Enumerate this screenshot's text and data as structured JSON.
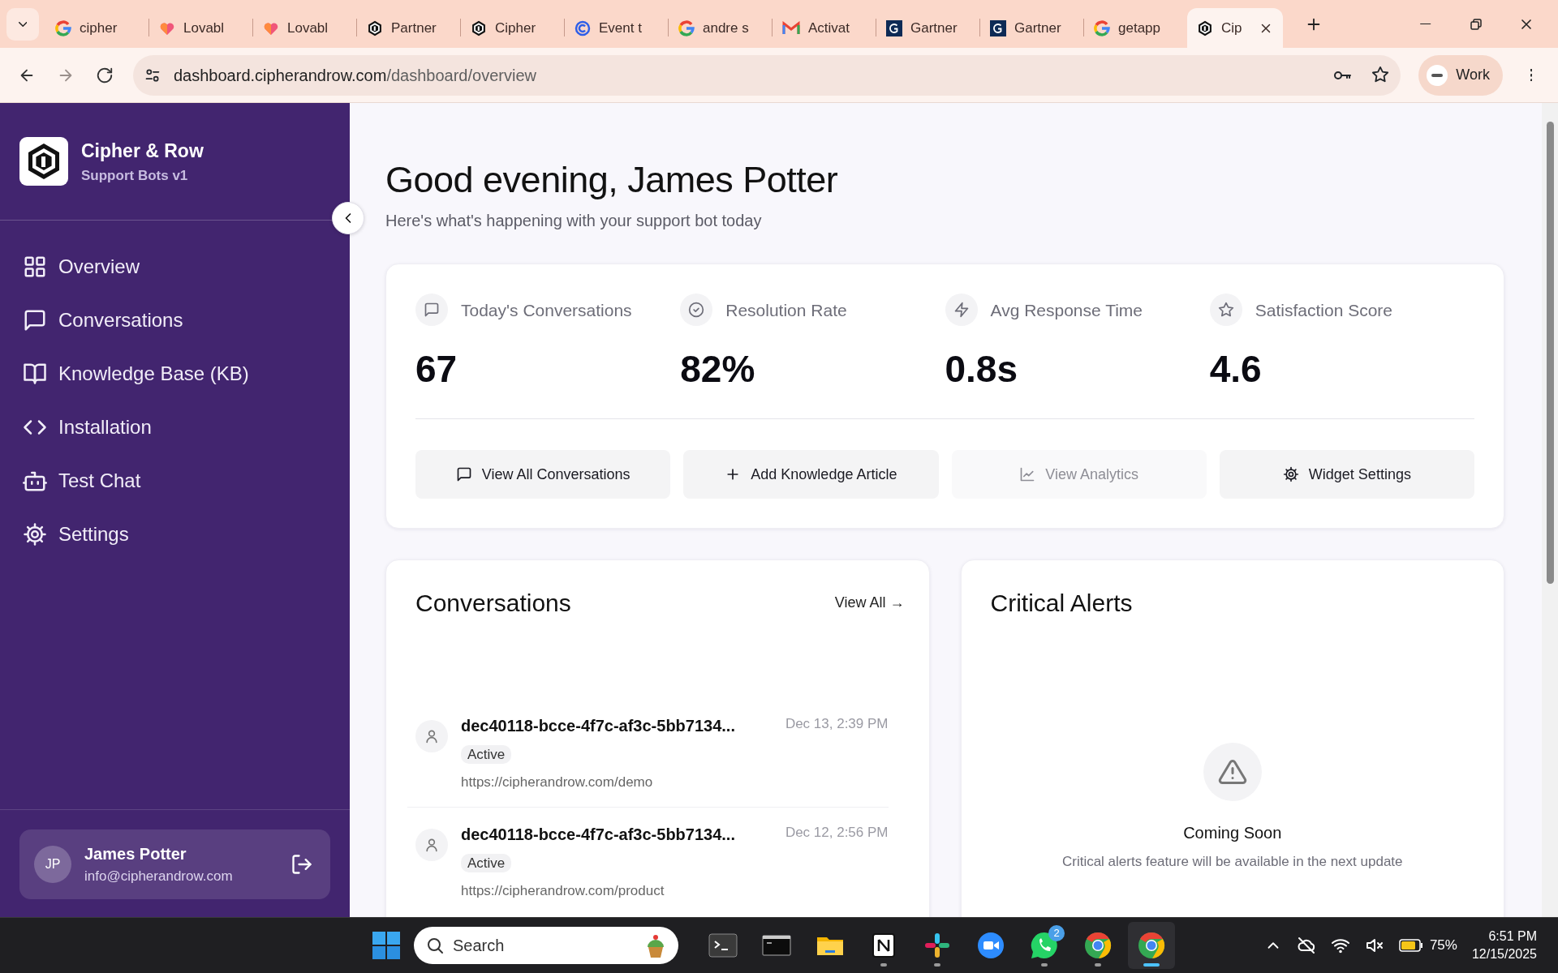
{
  "browser": {
    "tabs": [
      {
        "title": "cipher",
        "kind": "google",
        "selected": false
      },
      {
        "title": "Lovabl",
        "kind": "lovable",
        "selected": false
      },
      {
        "title": "Lovabl",
        "kind": "lovable",
        "selected": false
      },
      {
        "title": "Partner",
        "kind": "cipher",
        "selected": false
      },
      {
        "title": "Cipher",
        "kind": "cipher",
        "selected": false
      },
      {
        "title": "Event t",
        "kind": "event",
        "selected": false
      },
      {
        "title": "andre s",
        "kind": "google",
        "selected": false
      },
      {
        "title": "Activat",
        "kind": "gmail",
        "selected": false
      },
      {
        "title": "Gartner",
        "kind": "gartner",
        "selected": false
      },
      {
        "title": "Gartner",
        "kind": "gartner",
        "selected": false
      },
      {
        "title": "getapp",
        "kind": "google",
        "selected": false
      },
      {
        "title": "Cip",
        "kind": "cipher",
        "selected": true
      }
    ],
    "address": {
      "host": "dashboard.cipherandrow.com",
      "path": "/dashboard/overview"
    },
    "profile": "Work"
  },
  "sidebar": {
    "brand": "Cipher & Row",
    "subtitle": "Support Bots v1",
    "items": [
      {
        "label": "Overview",
        "kind": "grid",
        "selected": false
      },
      {
        "label": "Conversations",
        "kind": "chat",
        "selected": false
      },
      {
        "label": "Knowledge Base (KB)",
        "kind": "book",
        "selected": false
      },
      {
        "label": "Installation",
        "kind": "code",
        "selected": false
      },
      {
        "label": "Test Chat",
        "kind": "bot",
        "selected": false
      },
      {
        "label": "Settings",
        "kind": "gear",
        "selected": false
      }
    ],
    "user": {
      "initials": "JP",
      "name": "James Potter",
      "email": "info@cipherandrow.com"
    }
  },
  "header": {
    "title": "Good evening, James Potter",
    "subtitle": "Here's what's happening with your support bot today"
  },
  "stats": [
    {
      "label": "Today's Conversations",
      "value": "67",
      "kind": "chat"
    },
    {
      "label": "Resolution Rate",
      "value": "82%",
      "kind": "check"
    },
    {
      "label": "Avg Response Time",
      "value": "0.8s",
      "kind": "bolt"
    },
    {
      "label": "Satisfaction Score",
      "value": "4.6",
      "kind": "star"
    }
  ],
  "actions": [
    {
      "label": "View All Conversations",
      "kind": "chat",
      "disabled": false
    },
    {
      "label": "Add Knowledge Article",
      "kind": "plus",
      "disabled": false
    },
    {
      "label": "View Analytics",
      "kind": "chart",
      "disabled": true
    },
    {
      "label": "Widget Settings",
      "kind": "gear",
      "disabled": false
    }
  ],
  "conversations": {
    "title": "Conversations",
    "link": "View All →",
    "items": [
      {
        "id": "dec40118-bcce-4f7c-af3c-5bb7134...",
        "status": "Active",
        "url": "https://cipherandrow.com/demo",
        "time": "Dec 13, 2:39 PM"
      },
      {
        "id": "dec40118-bcce-4f7c-af3c-5bb7134...",
        "status": "Active",
        "url": "https://cipherandrow.com/product",
        "time": "Dec 12, 2:56 PM"
      }
    ]
  },
  "alerts": {
    "title": "Critical Alerts",
    "heading": "Coming Soon",
    "message": "Critical alerts feature will be available in the next update"
  },
  "taskbar": {
    "search": "Search",
    "apps": [
      {
        "kind": "terminal",
        "running": false,
        "selected": false
      },
      {
        "kind": "console",
        "running": false,
        "selected": false
      },
      {
        "kind": "folder",
        "running": false,
        "selected": false
      },
      {
        "kind": "notion",
        "running": true,
        "selected": false
      },
      {
        "kind": "slack",
        "running": true,
        "selected": false
      },
      {
        "kind": "zoom",
        "running": false,
        "selected": false
      },
      {
        "kind": "whatsapp",
        "running": true,
        "selected": false,
        "badge": "2"
      },
      {
        "kind": "chrome",
        "running": true,
        "selected": false
      },
      {
        "kind": "chrome",
        "running": true,
        "selected": true
      }
    ],
    "battery": "75%",
    "time": "6:51 PM",
    "date": "12/15/2025"
  }
}
